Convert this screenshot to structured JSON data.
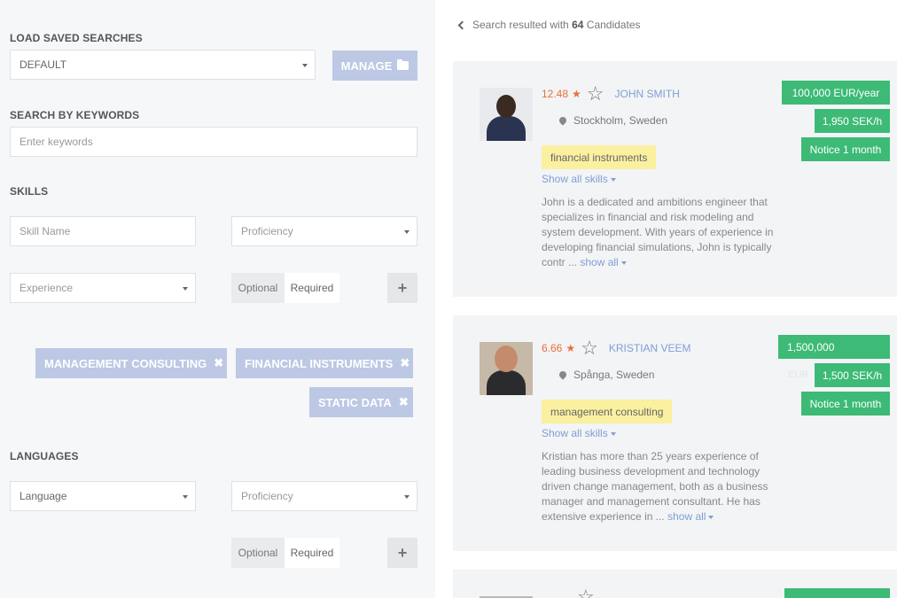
{
  "filters": {
    "saved_searches": {
      "title": "LOAD SAVED SEARCHES",
      "selected": "DEFAULT",
      "manage_label": "MANAGE"
    },
    "keywords": {
      "title": "SEARCH BY KEYWORDS",
      "placeholder": "Enter keywords"
    },
    "skills": {
      "title": "SKILLS",
      "name_placeholder": "Skill Name",
      "proficiency_placeholder": "Proficiency",
      "experience_placeholder": "Experience",
      "optional_label": "Optional",
      "required_label": "Required",
      "add_symbol": "+",
      "tags": [
        {
          "label": "MANAGEMENT CONSULTING"
        },
        {
          "label": "FINANCIAL INSTRUMENTS"
        },
        {
          "label": "STATIC DATA"
        }
      ],
      "remove_symbol": "✖"
    },
    "languages": {
      "title": "LANGUAGES",
      "language_placeholder": "Language",
      "proficiency_placeholder": "Proficiency",
      "optional_label": "Optional",
      "required_label": "Required",
      "add_symbol": "+"
    }
  },
  "results": {
    "summary_prefix": "Search resulted with",
    "count": "64",
    "summary_suffix": "Candidates",
    "candidates": [
      {
        "score": "12.48",
        "name": "JOHN SMITH",
        "location": "Stockholm, Sweden",
        "skill": "financial instruments",
        "show_skills": "Show all skills",
        "description": "John is a dedicated and ambitions engineer that specializes in financial and risk modeling and system development. With years of experience in developing financial simulations, John is typically contr ...",
        "show_all": "show all",
        "salary": "100,000  EUR/year",
        "rate": "1,950 SEK/h",
        "notice": "Notice 1 month"
      },
      {
        "score": "6.66",
        "name": "KRISTIAN VEEM",
        "location": "Spånga, Sweden",
        "skill": "management consulting",
        "show_skills": "Show all skills",
        "description": "Kristian has more than 25 years experience of leading business development and technology driven change management, both as a business manager and management consultant. He has extensive experience in ...",
        "show_all": "show all",
        "salary": "1,500,000",
        "rate": "1,500 SEK/h",
        "notice": "Notice 1 month",
        "faint_note": "EUR"
      }
    ]
  },
  "icons": {
    "star_solid": "★",
    "star_outline": "☆"
  },
  "colors": {
    "accent": "#7f9fd4",
    "tag_bg": "#bcc8e4",
    "badge": "#3dba76",
    "score": "#e8703a",
    "skill_highlight": "#faf0a0"
  }
}
